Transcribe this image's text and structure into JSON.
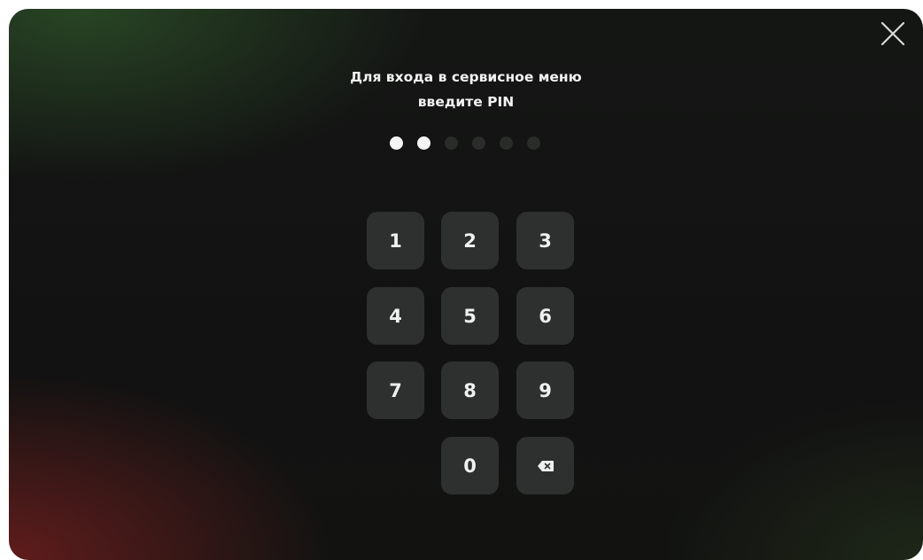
{
  "dialog": {
    "title_line1": "Для входа в сервисное меню",
    "title_line2": "введите PIN",
    "close_icon": "close-icon"
  },
  "pin": {
    "length": 6,
    "entered": 2
  },
  "keypad": {
    "keys": [
      "1",
      "2",
      "3",
      "4",
      "5",
      "6",
      "7",
      "8",
      "9",
      "0"
    ],
    "backspace_icon": "backspace-icon"
  },
  "colors": {
    "key_background": "#2e302f",
    "dot_filled": "#f4f4f4",
    "dot_empty": "#2a2c2a",
    "text": "#f2f2f2"
  }
}
